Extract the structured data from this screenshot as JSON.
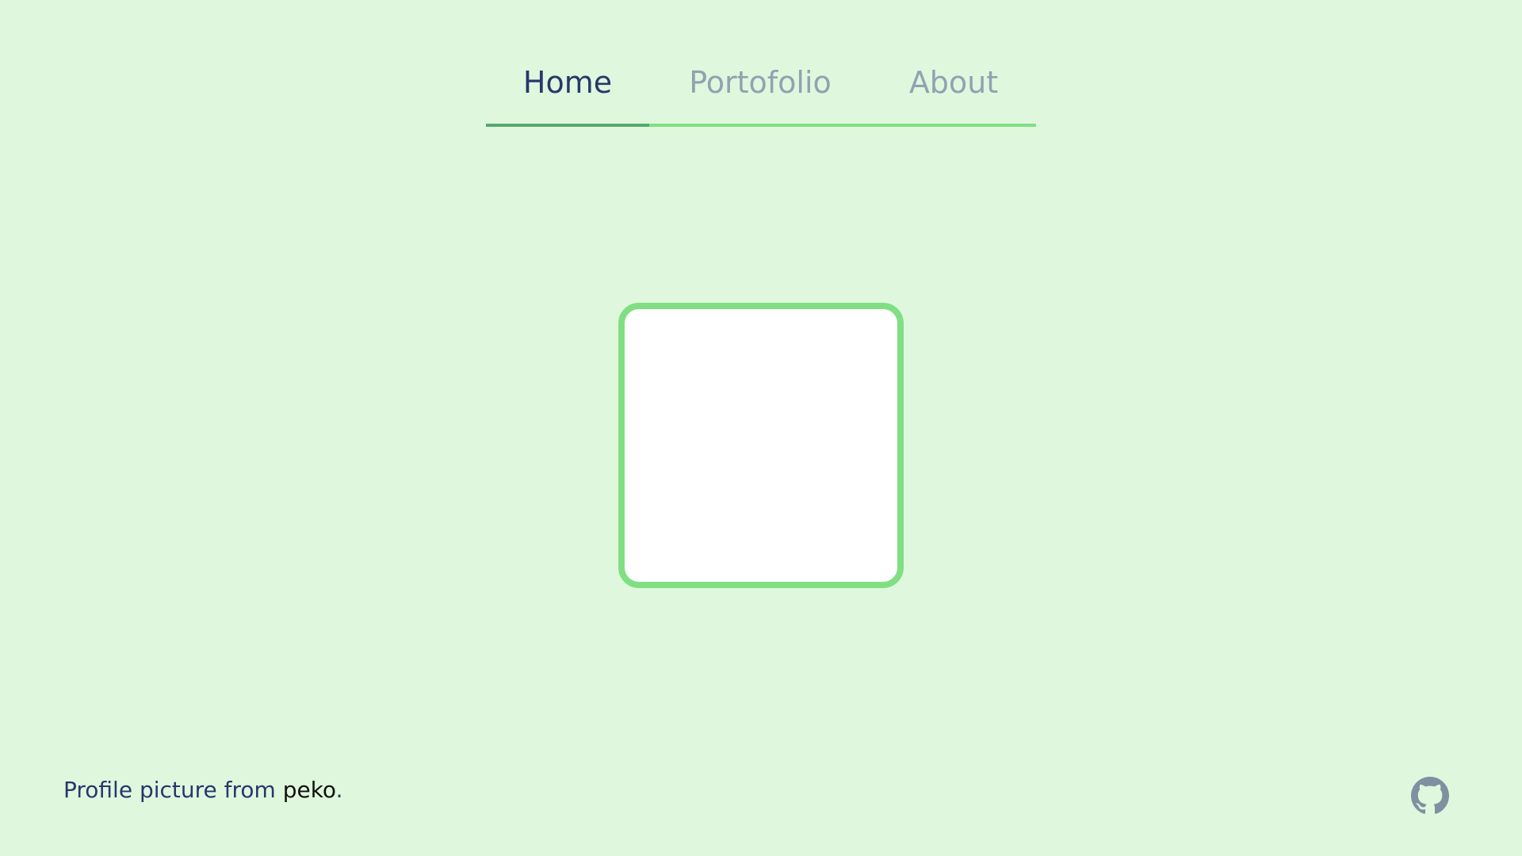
{
  "nav": {
    "tabs": [
      {
        "label": "Home",
        "active": true
      },
      {
        "label": "Portofolio",
        "active": false
      },
      {
        "label": "About",
        "active": false
      }
    ]
  },
  "profile": {
    "image_alt": ""
  },
  "footer": {
    "credit_prefix": "Profile picture from ",
    "credit_link": "peko",
    "credit_suffix": "."
  },
  "icons": {
    "github": "github-icon"
  },
  "colors": {
    "background": "#dff8dd",
    "accent": "#80df83",
    "active_underline": "#57a86d",
    "active_text": "#26386d",
    "inactive_text": "#8fa3b1"
  }
}
